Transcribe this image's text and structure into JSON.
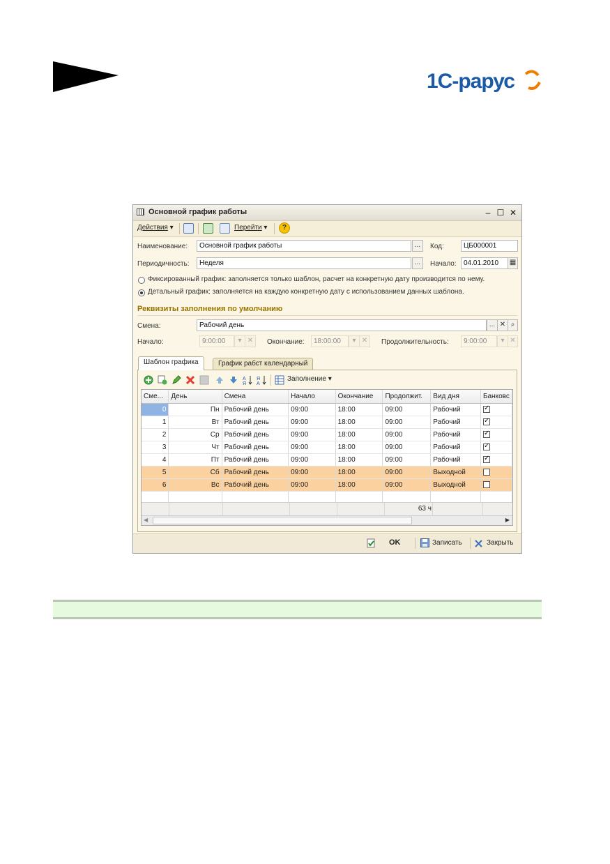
{
  "logo": {
    "text": "1С-РАРУС"
  },
  "window": {
    "title": "Основной график работы",
    "toolbar": {
      "actions_label": "Действия",
      "goto_label": "Перейти",
      "help_label": "?"
    },
    "form": {
      "name_label": "Наименование:",
      "name_value": "Основной график работы",
      "code_label": "Код:",
      "code_value": "ЦБ000001",
      "period_label": "Периодичность:",
      "period_value": "Неделя",
      "start_label": "Начало:",
      "start_value": "04.01.2010",
      "radio_fixed": "Фиксированный график: заполняется только шаблон, расчет на конкретную дату производится по нему.",
      "radio_detailed": "Детальный график: заполняется на каждую конкретную дату с использованием данных шаблона.",
      "selected_radio": "detailed",
      "defaults_title": "Реквизиты заполнения по умолчанию",
      "shift_label": "Смена:",
      "shift_value": "Рабочий день",
      "time_start_label": "Начало:",
      "time_start_value": "9:00:00",
      "time_end_label": "Окончание:",
      "time_end_value": "18:00:00",
      "duration_label": "Продолжительность:",
      "duration_value": "9:00:00"
    },
    "tabs": [
      {
        "label": "Шаблон графика",
        "active": true
      },
      {
        "label": "График рабст календарный",
        "active": false
      }
    ],
    "grid_toolbar": {
      "fill_label": "Заполнение"
    },
    "grid": {
      "columns": [
        "Сме...",
        "День",
        "Смена",
        "Начало",
        "Окончание",
        "Продолжит.",
        "Вид дня",
        "Банковс"
      ],
      "rows": [
        {
          "n": "0",
          "day": "Пн",
          "shift": "Рабочий день",
          "start": "09:00",
          "end": "18:00",
          "dur": "09:00",
          "kind": "Рабочий",
          "bank": true,
          "weekend": false
        },
        {
          "n": "1",
          "day": "Вт",
          "shift": "Рабочий день",
          "start": "09:00",
          "end": "18:00",
          "dur": "09:00",
          "kind": "Рабочий",
          "bank": true,
          "weekend": false
        },
        {
          "n": "2",
          "day": "Ср",
          "shift": "Рабочий день",
          "start": "09:00",
          "end": "18:00",
          "dur": "09:00",
          "kind": "Рабочий",
          "bank": true,
          "weekend": false
        },
        {
          "n": "3",
          "day": "Чт",
          "shift": "Рабочий день",
          "start": "09:00",
          "end": "18:00",
          "dur": "09:00",
          "kind": "Рабочий",
          "bank": true,
          "weekend": false
        },
        {
          "n": "4",
          "day": "Пт",
          "shift": "Рабочий день",
          "start": "09:00",
          "end": "18:00",
          "dur": "09:00",
          "kind": "Рабочий",
          "bank": true,
          "weekend": false
        },
        {
          "n": "5",
          "day": "Сб",
          "shift": "Рабочий день",
          "start": "09:00",
          "end": "18:00",
          "dur": "09:00",
          "kind": "Выходной",
          "bank": false,
          "weekend": true
        },
        {
          "n": "6",
          "day": "Вс",
          "shift": "Рабочий день",
          "start": "09:00",
          "end": "18:00",
          "dur": "09:00",
          "kind": "Выходной",
          "bank": false,
          "weekend": true
        }
      ],
      "total": "63 ч"
    },
    "bottom": {
      "ok_label": "OK",
      "save_label": "Записать",
      "close_label": "Закрыть"
    }
  },
  "colors": {
    "weekend_row": "#fbd1a0",
    "accent_title": "#9a7400",
    "logo_blue": "#1b5aa6",
    "logo_orange": "#f07d00",
    "green_bar": "#e6fae0"
  }
}
